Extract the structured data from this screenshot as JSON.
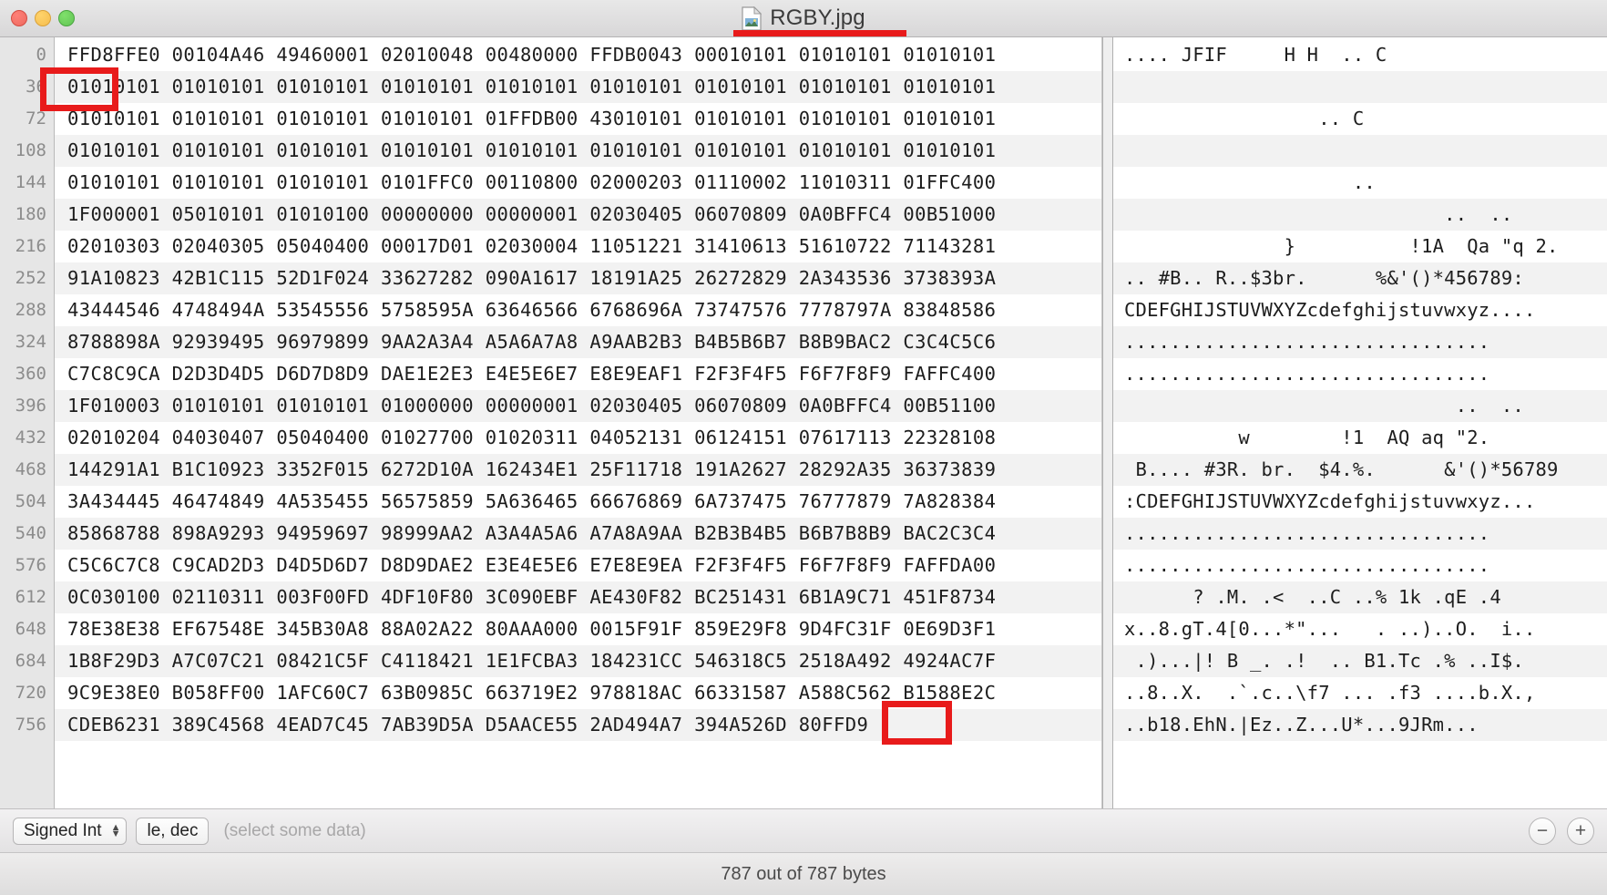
{
  "window": {
    "title": "RGBY.jpg",
    "doc_icon": "jpeg-file-icon",
    "traffic_lights": [
      {
        "name": "close-button",
        "color": "#ed6a5f"
      },
      {
        "name": "minimize-button",
        "color": "#f5bd4f"
      },
      {
        "name": "zoom-button",
        "color": "#61c454"
      }
    ]
  },
  "annotations": {
    "color": "#e81b1b",
    "title_underline": "title-underline",
    "start_marker_label": "FFD8",
    "end_marker_label": "FFD9"
  },
  "hex_view": {
    "offsets": [
      "0",
      "36",
      "72",
      "108",
      "144",
      "180",
      "216",
      "252",
      "288",
      "324",
      "360",
      "396",
      "432",
      "468",
      "504",
      "540",
      "576",
      "612",
      "648",
      "684",
      "720",
      "756"
    ],
    "rows": [
      "FFD8FFE0 00104A46 49460001 02010048 00480000 FFDB0043 00010101 01010101 01010101",
      "01010101 01010101 01010101 01010101 01010101 01010101 01010101 01010101 01010101",
      "01010101 01010101 01010101 01010101 01FFDB00 43010101 01010101 01010101 01010101",
      "01010101 01010101 01010101 01010101 01010101 01010101 01010101 01010101 01010101",
      "01010101 01010101 01010101 0101FFC0 00110800 02000203 01110002 11010311 01FFC400",
      "1F000001 05010101 01010100 00000000 00000001 02030405 06070809 0A0BFFC4 00B51000",
      "02010303 02040305 05040400 00017D01 02030004 11051221 31410613 51610722 71143281",
      "91A10823 42B1C115 52D1F024 33627282 090A1617 18191A25 26272829 2A343536 3738393A",
      "43444546 4748494A 53545556 5758595A 63646566 6768696A 73747576 7778797A 83848586",
      "8788898A 92939495 96979899 9AA2A3A4 A5A6A7A8 A9AAB2B3 B4B5B6B7 B8B9BAC2 C3C4C5C6",
      "C7C8C9CA D2D3D4D5 D6D7D8D9 DAE1E2E3 E4E5E6E7 E8E9EAF1 F2F3F4F5 F6F7F8F9 FAFFC400",
      "1F010003 01010101 01010101 01000000 00000001 02030405 06070809 0A0BFFC4 00B51100",
      "02010204 04030407 05040400 01027700 01020311 04052131 06124151 07617113 22328108",
      "144291A1 B1C10923 3352F015 6272D10A 162434E1 25F11718 191A2627 28292A35 36373839",
      "3A434445 46474849 4A535455 56575859 5A636465 66676869 6A737475 76777879 7A828384",
      "85868788 898A9293 94959697 98999AA2 A3A4A5A6 A7A8A9AA B2B3B4B5 B6B7B8B9 BAC2C3C4",
      "C5C6C7C8 C9CAD2D3 D4D5D6D7 D8D9DAE2 E3E4E5E6 E7E8E9EA F2F3F4F5 F6F7F8F9 FAFFDA00",
      "0C030100 02110311 003F00FD 4DF10F80 3C090EBF AE430F82 BC251431 6B1A9C71 451F8734",
      "78E38E38 EF67548E 345B30A8 88A02A22 80AAA000 0015F91F 859E29F8 9D4FC31F 0E69D3F1",
      "1B8F29D3 A7C07C21 08421C5F C4118421 1E1FCBA3 184231CC 546318C5 2518A492 4924AC7F",
      "9C9E38E0 B058FF00 1AFC60C7 63B0985C 663719E2 978818AC 66331587 A588C562 B1588E2C",
      "CDEB6231 389C4568 4EAD7C45 7AB39D5A D5AACE55 2AD494A7 394A526D 80FFD9"
    ]
  },
  "ascii_view": {
    "rows": [
      ".... JFIF     H H  .. C",
      "",
      "                 .. C",
      "",
      "                    ..",
      "                            ..  ..",
      "              }          !1A  Qa \"q 2.",
      ".. #B.. R..$3br.      %&'()*456789:",
      "CDEFGHIJSTUVWXYZcdefghijstuvwxyz....",
      "................................",
      "................................",
      "                             ..  ..",
      "          w        !1  AQ aq \"2.",
      " B.... #3R. br.  $4.%.      &'()*56789",
      ":CDEFGHIJSTUVWXYZcdefghijstuvwxyz...",
      "................................",
      "................................",
      "      ? .M. .<  ..C ..% 1k .qE .4",
      "x..8.gT.4[0...*\"...   . ..)..O.  i..",
      " .)...|! B _. .!  .. B1.Tc .% ..I$.",
      "..8..X.  .`.c..\\f7 ... .f3 ....b.X.,",
      "..b18.EhN.|Ez..Z...U*...9JRm..."
    ]
  },
  "inspector": {
    "type_popup": "Signed Int",
    "type_popup_glyph": "stepper-chevrons",
    "format_pill": "le, dec",
    "placeholder": "(select some data)",
    "zoom_out_label": "−",
    "zoom_in_label": "+"
  },
  "status": {
    "text": "787 out of 787 bytes"
  }
}
